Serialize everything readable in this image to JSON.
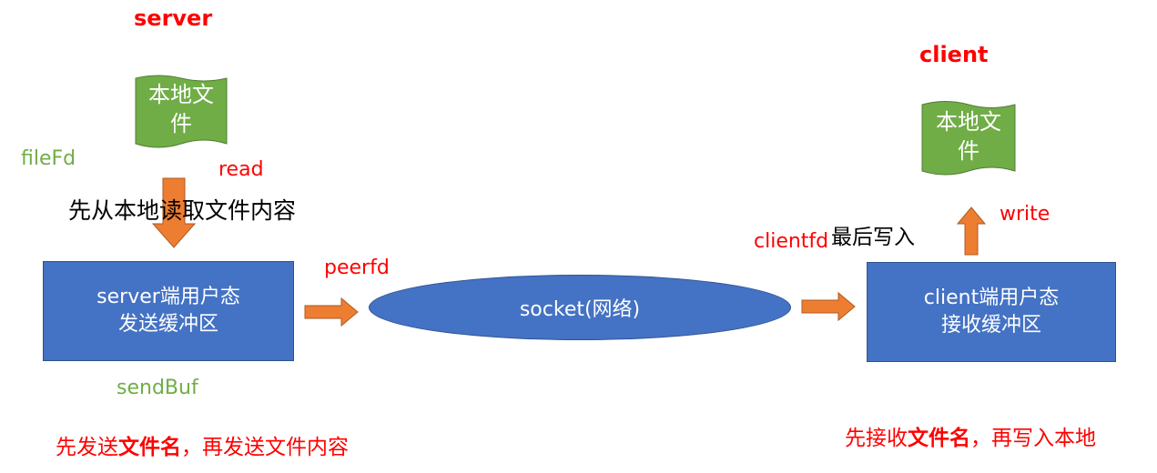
{
  "server": {
    "title": "server",
    "doc_label_line1": "本地文",
    "doc_label_line2": "件",
    "file_fd": "fileFd",
    "read": "read",
    "read_note": "先从本地读取文件内容",
    "buffer_line1": "server端用户态",
    "buffer_line2": "发送缓冲区",
    "send_buf": "sendBuf",
    "bottom_note_prefix": "先发送",
    "bottom_note_bold": "文件名",
    "bottom_note_suffix": "，再发送文件内容"
  },
  "socket": {
    "peerfd": "peerfd",
    "label": "socket(网络)"
  },
  "client": {
    "title": "client",
    "doc_label_line1": "本地文",
    "doc_label_line2": "件",
    "clientfd": "clientfd",
    "write_note": "最后写入",
    "write": "write",
    "buffer_line1": "client端用户态",
    "buffer_line2": "接收缓冲区",
    "bottom_note_prefix": "先接收",
    "bottom_note_bold": "文件名",
    "bottom_note_suffix": "，再写入本地"
  },
  "colors": {
    "box_fill": "#4472c4",
    "doc_fill": "#70ad47",
    "arrow_fill": "#ed7d31",
    "label_red": "#ff0000",
    "label_green": "#70ad47"
  },
  "icons": [
    "document-shape-icon",
    "arrow-right-icon",
    "arrow-down-icon",
    "arrow-up-icon"
  ]
}
